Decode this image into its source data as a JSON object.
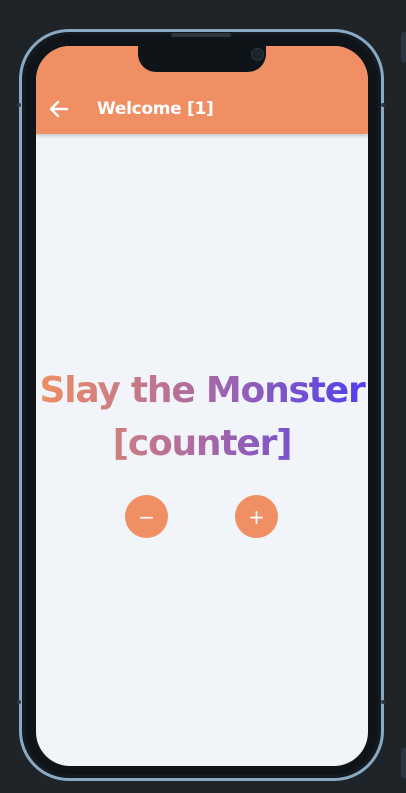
{
  "appbar": {
    "title": "Welcome [1]",
    "back_icon": "arrow-left-icon",
    "color": "#f08f64"
  },
  "main": {
    "headline_line1": "Slay the Monster",
    "headline_line2": "[counter]",
    "gradient": [
      "#ef8f62",
      "#b26e9c",
      "#4f3ef0"
    ]
  },
  "controls": {
    "decrement_label": "−",
    "increment_label": "+",
    "decrement_icon": "minus-icon",
    "increment_icon": "plus-icon",
    "color": "#f08f64"
  },
  "theme": {
    "screen_background": "#f1f4f8",
    "page_background": "#1f2429",
    "device_rim": "#8aa9c3"
  }
}
